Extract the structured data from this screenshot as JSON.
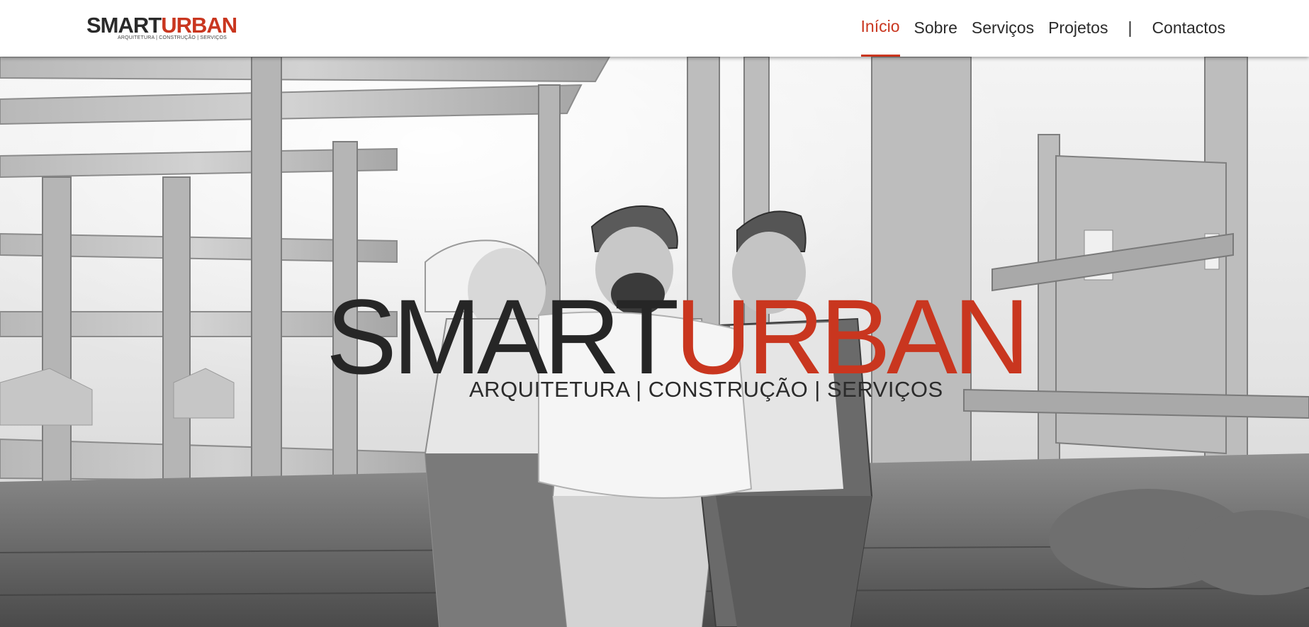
{
  "header": {
    "logo": {
      "word_dark": "SMART",
      "word_red": "URBAN",
      "tagline": "ARQUITETURA | CONSTRUÇÃO | SERVIÇOS"
    },
    "nav": {
      "items": [
        {
          "label": "Início",
          "active": true
        },
        {
          "label": "Sobre",
          "active": false
        },
        {
          "label": "Serviços",
          "active": false
        },
        {
          "label": "Projetos",
          "active": false
        }
      ],
      "separator": "|",
      "contact_label": "Contactos"
    }
  },
  "hero": {
    "logo": {
      "word_dark": "SMART",
      "word_red": "URBAN",
      "tagline": "ARQUITETURA | CONSTRUÇÃO | SERVIÇOS"
    },
    "background_image": "grayscale-construction-site-with-three-engineers"
  },
  "colors": {
    "accent": "#c9361f",
    "text": "#2b2b2b"
  }
}
